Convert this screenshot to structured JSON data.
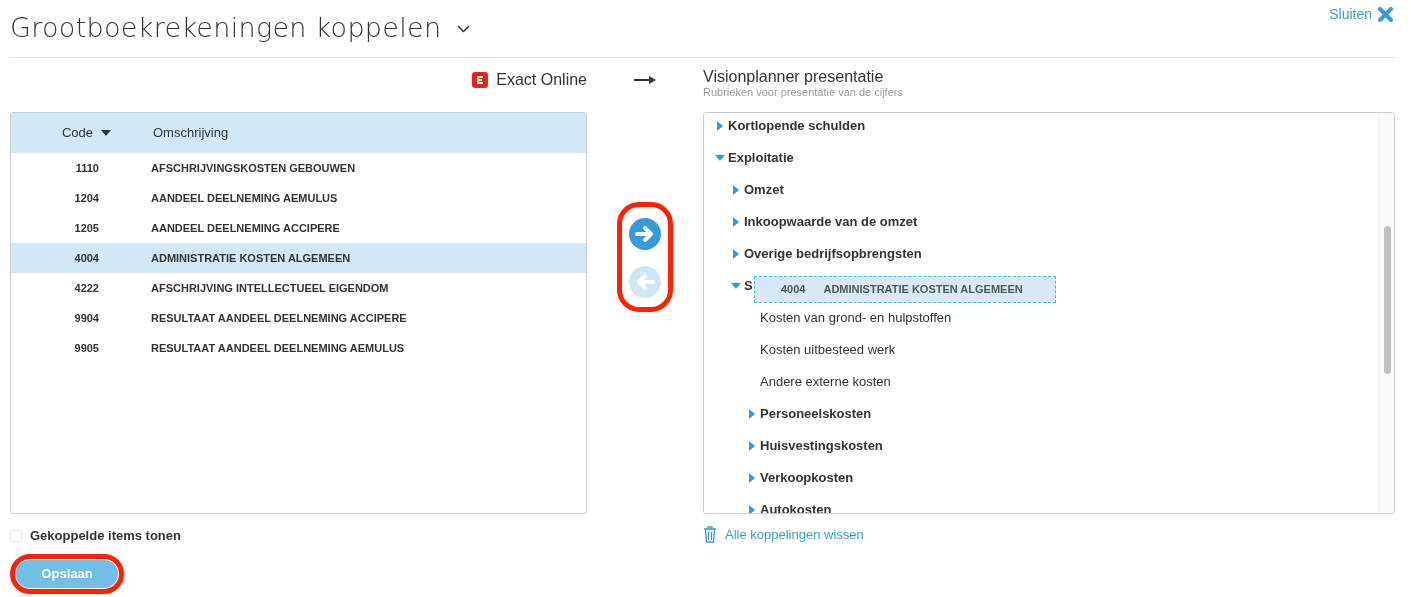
{
  "header": {
    "title": "Grootboekrekeningen koppelen",
    "close_label": "Sluiten"
  },
  "source": {
    "name": "Exact Online"
  },
  "target": {
    "name": "Visionplanner presentatie",
    "subtitle": "Rubrieken voor presentatie van de cijfers"
  },
  "table": {
    "columns": [
      {
        "label": "Code",
        "sorted": true
      },
      {
        "label": "Omschrijving",
        "sorted": false
      }
    ],
    "rows": [
      {
        "code": "1110",
        "description": "AFSCHRIJVINGSKOSTEN GEBOUWEN",
        "selected": false
      },
      {
        "code": "1204",
        "description": "AANDEEL DEELNEMING AEMULUS",
        "selected": false
      },
      {
        "code": "1205",
        "description": "AANDEEL DEELNEMING ACCIPERE",
        "selected": false
      },
      {
        "code": "4004",
        "description": "ADMINISTRATIE KOSTEN ALGEMEEN",
        "selected": true
      },
      {
        "code": "4222",
        "description": "AFSCHRIJVING INTELLECTUEEL EIGENDOM",
        "selected": false
      },
      {
        "code": "9904",
        "description": "RESULTAAT AANDEEL DEELNEMING ACCIPERE",
        "selected": false
      },
      {
        "code": "9905",
        "description": "RESULTAAT AANDEEL DEELNEMING AEMULUS",
        "selected": false
      }
    ]
  },
  "transfer": {
    "highlighted": true,
    "buttons": [
      {
        "kind": "forward",
        "disabled": false
      },
      {
        "kind": "back",
        "disabled": true
      }
    ]
  },
  "tree": {
    "items": [
      {
        "children": [
          {
            "label": "Kortlopende schulden",
            "expanded": false
          }
        ]
      },
      {
        "label": "Exploitatie",
        "expanded": true,
        "children": [
          {
            "label": "Omzet",
            "expanded": false
          },
          {
            "label": "Inkoopwaarde van de omzet",
            "expanded": false
          },
          {
            "label": "Overige bedrijfsopbrengsten",
            "expanded": false
          },
          {
            "label": "S",
            "expanded": true,
            "children": [
              {
                "label": "Kosten van grond- en hulpstoffen"
              },
              {
                "label": "Kosten uitbesteed werk"
              },
              {
                "label": "Andere externe kosten"
              },
              {
                "label": "Personeelskosten",
                "expanded": false
              },
              {
                "label": "Huisvestingskosten",
                "expanded": false
              },
              {
                "label": "Verkoopkosten",
                "expanded": false
              },
              {
                "label": "Autokosten",
                "expanded": false
              }
            ]
          }
        ]
      }
    ]
  },
  "drag_ghost": {
    "code": "4004",
    "description": "ADMINISTRATIE KOSTEN ALGEMEEN"
  },
  "show_linked": {
    "label": "Gekoppelde items tonen",
    "checked": false
  },
  "clear_link": {
    "label": "Alle koppelingen wissen"
  },
  "save": {
    "label": "Opslaan",
    "highlighted": true
  }
}
